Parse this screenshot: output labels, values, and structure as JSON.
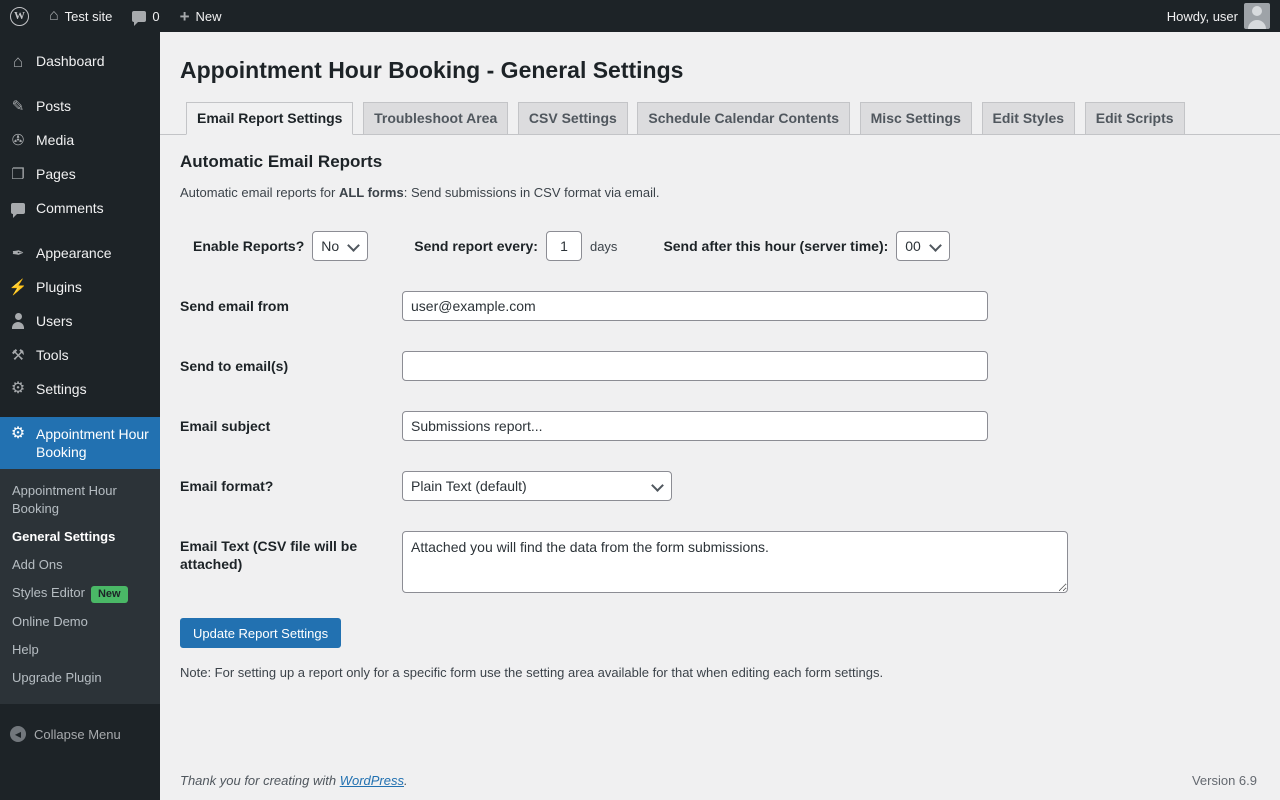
{
  "admin_bar": {
    "site_name": "Test site",
    "comments_count": "0",
    "new_label": "New",
    "howdy": "Howdy, user"
  },
  "sidebar": {
    "items": [
      "Dashboard",
      "Posts",
      "Media",
      "Pages",
      "Comments",
      "Appearance",
      "Plugins",
      "Users",
      "Tools",
      "Settings",
      "Appointment Hour Booking"
    ],
    "submenu": [
      "Appointment Hour Booking",
      "General Settings",
      "Add Ons",
      "Styles Editor",
      "Online Demo",
      "Help",
      "Upgrade Plugin"
    ],
    "new_badge": "New",
    "collapse_label": "Collapse Menu"
  },
  "page": {
    "title": "Appointment Hour Booking - General Settings",
    "tabs": [
      "Email Report Settings",
      "Troubleshoot Area",
      "CSV Settings",
      "Schedule Calendar Contents",
      "Misc Settings",
      "Edit Styles",
      "Edit Scripts"
    ],
    "section_title": "Automatic Email Reports",
    "intro_prefix": "Automatic email reports for ",
    "intro_bold": "ALL forms",
    "intro_suffix": ": Send submissions in CSV format via email.",
    "fields": {
      "enable_label": "Enable Reports?",
      "enable_value": "No",
      "every_label": "Send report every:",
      "every_value": "1",
      "every_suffix": "days",
      "hour_label": "Send after this hour (server time):",
      "hour_value": "00",
      "from_label": "Send email from",
      "from_value": "user@example.com",
      "to_label": "Send to email(s)",
      "to_value": "",
      "subject_label": "Email subject",
      "subject_value": "Submissions report...",
      "format_label": "Email format?",
      "format_value": "Plain Text (default)",
      "text_label": "Email Text (CSV file will be attached)",
      "text_value": "Attached you will find the data from the form submissions."
    },
    "update_button": "Update Report Settings",
    "note": "Note: For setting up a report only for a specific form use the setting area available for that when editing each form settings."
  },
  "footer": {
    "thanks_prefix": "Thank you for creating with ",
    "link_label": "WordPress",
    "thanks_suffix": ".",
    "version": "Version 6.9"
  },
  "colors": {
    "accent": "#2271b1",
    "sidebar_bg": "#1d2327",
    "submenu_bg": "#2c3338",
    "badge_green": "#4ab866",
    "page_bg": "#f0f0f1"
  }
}
